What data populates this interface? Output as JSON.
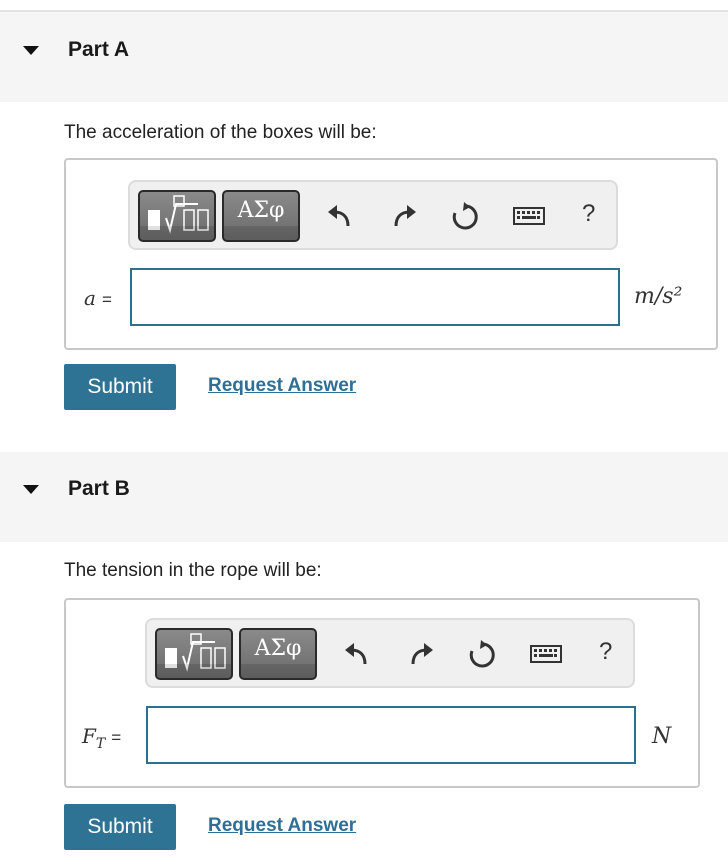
{
  "parts": [
    {
      "title": "Part A",
      "question": "The acceleration of the boxes will be:",
      "variable": "a",
      "variable_sub": "",
      "unit": "m/s²",
      "input_value": "",
      "submit_label": "Submit",
      "request_label": "Request Answer"
    },
    {
      "title": "Part B",
      "question": "The tension in the rope will be:",
      "variable": "F",
      "variable_sub": "T",
      "unit": "N",
      "input_value": "",
      "submit_label": "Submit",
      "request_label": "Request Answer"
    }
  ],
  "toolbar": {
    "greek_label": "ΑΣφ",
    "help_label": "?",
    "equals": "="
  },
  "icons": [
    "caret-down-icon",
    "templates-icon",
    "undo-icon",
    "redo-icon",
    "reset-icon",
    "keyboard-icon",
    "help-icon"
  ]
}
